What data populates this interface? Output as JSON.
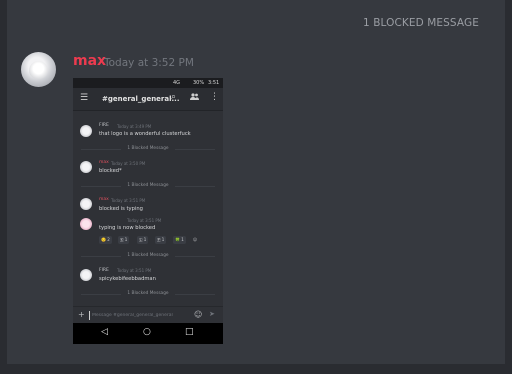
{
  "banner": {
    "blocked_count": "1 BLOCKED MESSAGE"
  },
  "post": {
    "username": "max",
    "timestamp": "Today at 3:52 PM"
  },
  "phone": {
    "status": {
      "network": "4G",
      "battery": "30%",
      "time": "3:51"
    },
    "appbar": {
      "menu_icon": "☰",
      "channel": "#general_general...",
      "search_icon": "⌕",
      "members_icon": "👥",
      "more_icon": "⋮"
    },
    "messages": [
      {
        "name": "FIRE",
        "time": "Today at 3:49 PM",
        "text": "that logo is a wonderful clusterfuck"
      },
      {
        "name": "max",
        "time": "Today at 3:50 PM",
        "text": "blocked*"
      },
      {
        "name": "max",
        "time": "Today at 3:51 PM",
        "text": "blocked is typing"
      },
      {
        "name": "",
        "time": "Today at 3:51 PM",
        "text": "typing is now blocked"
      },
      {
        "name": "FIRE",
        "time": "Today at 3:51 PM",
        "text": "spicykebifeebbadman"
      }
    ],
    "blocked_label": "1 Blocked Message",
    "reactions": [
      "🙂 2",
      "🇰 1",
      "🇱 1",
      "🇫 1",
      "🍀 1",
      "☺"
    ],
    "composer": {
      "placeholder": "Message #general_general_general",
      "plus_icon": "+",
      "emoji_icon": "☺",
      "send_icon": "➤"
    },
    "navbar": {
      "back": "◁",
      "home": "○",
      "recents": "□"
    }
  }
}
